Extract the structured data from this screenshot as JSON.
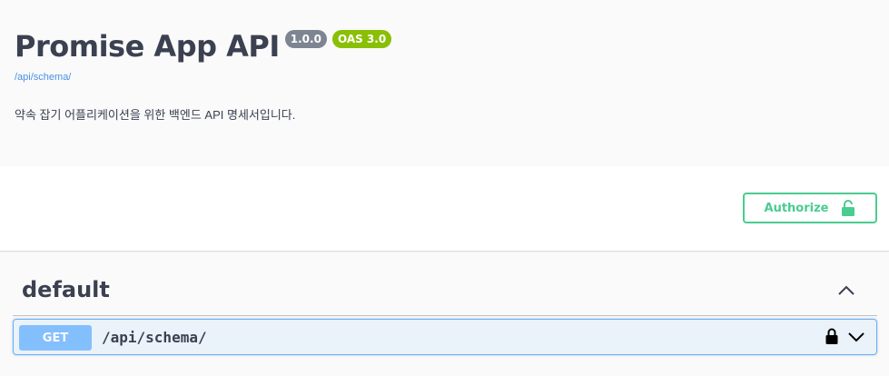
{
  "info": {
    "title": "Promise App API",
    "version": "1.0.0",
    "oas_version": "OAS 3.0",
    "schema_link": "/api/schema/",
    "description": "약속 잡기 어플리케이션을 위한 백엔드 API 명세서입니다."
  },
  "authorize": {
    "label": "Authorize",
    "icon": "lock-open-icon",
    "color": "#49cc90"
  },
  "tag": {
    "name": "default",
    "expanded": true,
    "icon": "chevron-up-icon"
  },
  "operations": [
    {
      "method": "GET",
      "path": "/api/schema/",
      "method_color": "#61affe",
      "locked": true
    }
  ]
}
